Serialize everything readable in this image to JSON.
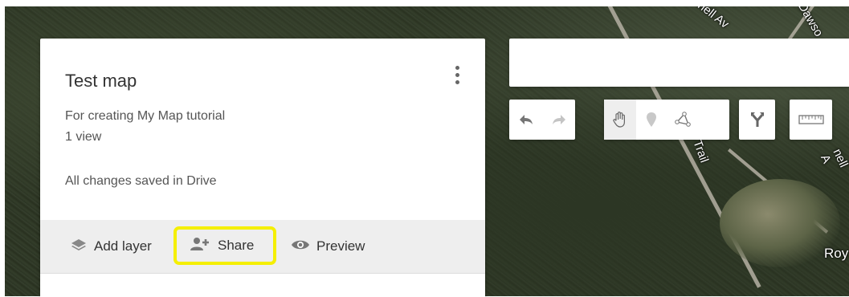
{
  "map": {
    "labels": [
      "nell Av",
      "Dawso",
      "Trail",
      "nell A",
      "Roy"
    ]
  },
  "panel": {
    "title": "Test map",
    "description": "For creating My Map tutorial",
    "views": "1 view",
    "save_status": "All changes saved in Drive",
    "actions": {
      "add_layer": "Add layer",
      "share": "Share",
      "preview": "Preview"
    }
  },
  "search": {
    "placeholder": "",
    "value": ""
  },
  "toolbar": {
    "buttons": [
      "undo",
      "redo",
      "select-pan",
      "add-marker",
      "draw-line",
      "add-directions",
      "measure-distance"
    ],
    "selected": "select-pan"
  },
  "colors": {
    "highlight": "#f5ef00",
    "panel_bg": "#ffffff",
    "action_bar_bg": "#eeeeee"
  }
}
